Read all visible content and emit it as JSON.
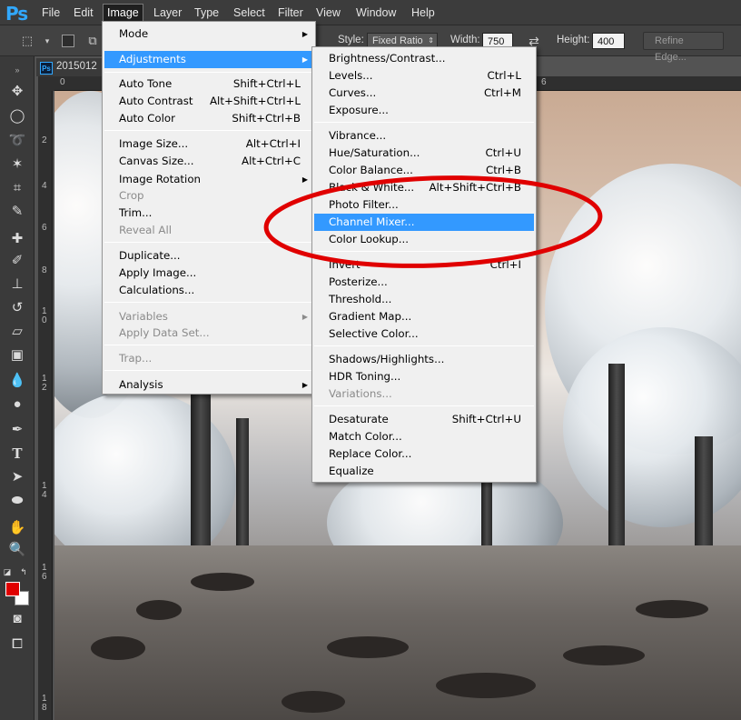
{
  "menubar": {
    "logo": "Ps",
    "items": [
      "File",
      "Edit",
      "Image",
      "Layer",
      "Type",
      "Select",
      "Filter",
      "View",
      "Window",
      "Help"
    ],
    "active": "Image"
  },
  "options": {
    "style_label": "Style:",
    "style_value": "Fixed Ratio",
    "width_label": "Width:",
    "width_value": "750",
    "height_label": "Height:",
    "height_value": "400",
    "refine_edge": "Refine Edge...",
    "swap_icon": "swap-arrows-icon"
  },
  "document": {
    "tab_title": "2015012",
    "ruler_h": [
      "0",
      "6"
    ],
    "ruler_v": [
      "2",
      "4",
      "6",
      "8",
      "10",
      "12",
      "14",
      "16",
      "18"
    ]
  },
  "image_menu": {
    "items": [
      {
        "label": "Mode",
        "submenu": true
      },
      {
        "label": "Adjustments",
        "submenu": true,
        "highlighted": true
      },
      {
        "label": "Auto Tone",
        "shortcut": "Shift+Ctrl+L"
      },
      {
        "label": "Auto Contrast",
        "shortcut": "Alt+Shift+Ctrl+L"
      },
      {
        "label": "Auto Color",
        "shortcut": "Shift+Ctrl+B"
      },
      {
        "label": "Image Size...",
        "shortcut": "Alt+Ctrl+I"
      },
      {
        "label": "Canvas Size...",
        "shortcut": "Alt+Ctrl+C"
      },
      {
        "label": "Image Rotation",
        "submenu": true
      },
      {
        "label": "Crop",
        "disabled": true
      },
      {
        "label": "Trim..."
      },
      {
        "label": "Reveal All",
        "disabled": true
      },
      {
        "label": "Duplicate..."
      },
      {
        "label": "Apply Image..."
      },
      {
        "label": "Calculations..."
      },
      {
        "label": "Variables",
        "submenu": true,
        "disabled": true
      },
      {
        "label": "Apply Data Set...",
        "disabled": true
      },
      {
        "label": "Trap...",
        "disabled": true
      },
      {
        "label": "Analysis",
        "submenu": true
      }
    ]
  },
  "adjustments_menu": {
    "items": [
      {
        "label": "Brightness/Contrast..."
      },
      {
        "label": "Levels...",
        "shortcut": "Ctrl+L"
      },
      {
        "label": "Curves...",
        "shortcut": "Ctrl+M"
      },
      {
        "label": "Exposure..."
      },
      {
        "label": "Vibrance..."
      },
      {
        "label": "Hue/Saturation...",
        "shortcut": "Ctrl+U"
      },
      {
        "label": "Color Balance...",
        "shortcut": "Ctrl+B"
      },
      {
        "label": "Black & White...",
        "shortcut": "Alt+Shift+Ctrl+B"
      },
      {
        "label": "Photo Filter..."
      },
      {
        "label": "Channel Mixer...",
        "highlighted": true
      },
      {
        "label": "Color Lookup..."
      },
      {
        "label": "Invert",
        "shortcut": "Ctrl+I"
      },
      {
        "label": "Posterize..."
      },
      {
        "label": "Threshold..."
      },
      {
        "label": "Gradient Map..."
      },
      {
        "label": "Selective Color..."
      },
      {
        "label": "Shadows/Highlights..."
      },
      {
        "label": "HDR Toning..."
      },
      {
        "label": "Variations...",
        "disabled": true
      },
      {
        "label": "Desaturate",
        "shortcut": "Shift+Ctrl+U"
      },
      {
        "label": "Match Color..."
      },
      {
        "label": "Replace Color..."
      },
      {
        "label": "Equalize"
      }
    ]
  },
  "colors": {
    "foreground": "#e00000",
    "background": "#ffffff",
    "highlight": "#3399ff",
    "annotation": "#e00000"
  }
}
